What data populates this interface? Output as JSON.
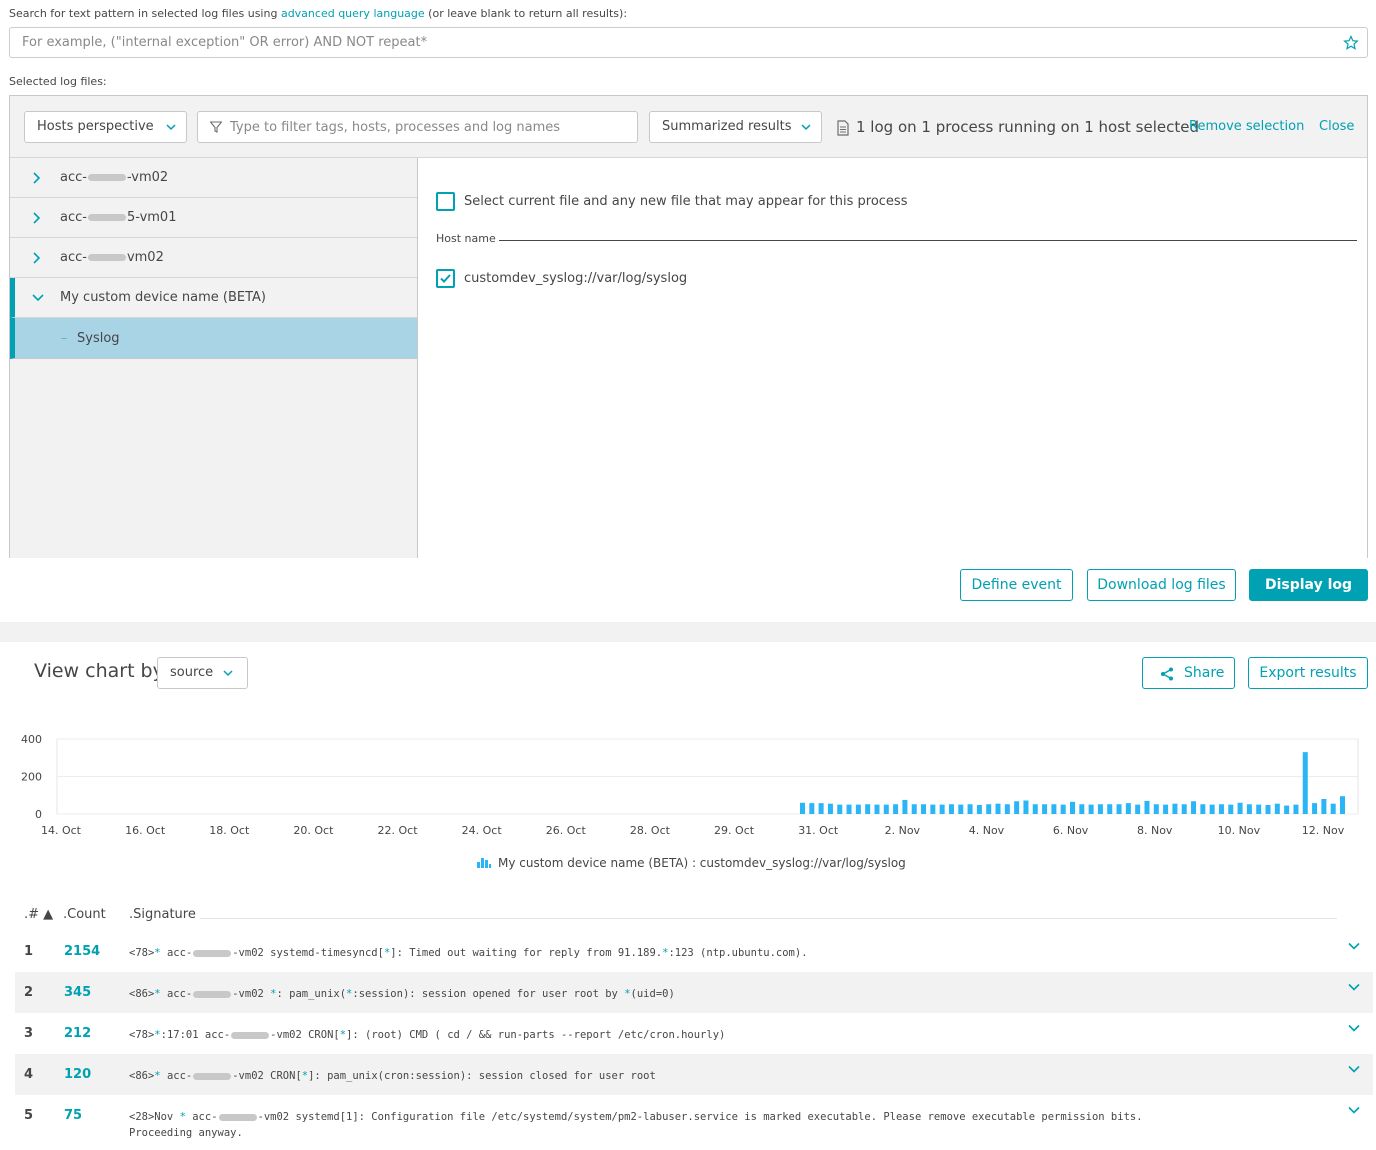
{
  "search": {
    "label_prefix": "Search for text pattern in selected log files using ",
    "label_link": "advanced query language",
    "label_suffix": " (or leave blank to return all results):",
    "placeholder": "For example, (\"internal exception\" OR error) AND NOT repeat*"
  },
  "selected_label": "Selected log files:",
  "toolbar": {
    "perspective": "Hosts perspective",
    "filter_placeholder": "Type to filter tags, hosts, processes and log names",
    "results_mode": "Summarized results",
    "selection_summary": "1 log on 1 process running on 1 host selected",
    "remove_selection": "Remove selection",
    "close": "Close"
  },
  "tree": {
    "items": [
      {
        "pre": "acc-",
        "post": "-vm02"
      },
      {
        "pre": "acc-",
        "post": "5-vm01"
      },
      {
        "pre": "acc-",
        "post": "vm02"
      },
      {
        "label": "My custom device name (BETA)"
      },
      {
        "label": "Syslog"
      }
    ]
  },
  "right_pane": {
    "select_current": "Select current file and any new file that may appear for this process",
    "host_name": "Host name",
    "file_entry": "customdev_syslog://var/log/syslog"
  },
  "actions": {
    "define_event": "Define event",
    "download": "Download log files",
    "display": "Display log"
  },
  "chart_section": {
    "view_by": "View chart by",
    "view_by_value": "source",
    "share": "Share",
    "export": "Export results"
  },
  "chart_data": {
    "type": "bar",
    "yticks": [
      "400",
      "200",
      "0"
    ],
    "xticks": [
      "14. Oct",
      "16. Oct",
      "18. Oct",
      "20. Oct",
      "22. Oct",
      "24. Oct",
      "26. Oct",
      "28. Oct",
      "29. Oct",
      "31. Oct",
      "2. Nov",
      "4. Nov",
      "6. Nov",
      "8. Nov",
      "10. Nov",
      "12. Nov"
    ],
    "ylim": [
      0,
      400
    ],
    "values": [
      60,
      58,
      58,
      55,
      50,
      50,
      50,
      52,
      50,
      50,
      52,
      75,
      52,
      52,
      50,
      50,
      52,
      50,
      52,
      48,
      52,
      55,
      52,
      68,
      72,
      52,
      52,
      52,
      50,
      65,
      52,
      50,
      52,
      52,
      52,
      58,
      50,
      70,
      52,
      50,
      55,
      52,
      68,
      52,
      50,
      52,
      50,
      60,
      52,
      50,
      48,
      55,
      45,
      50,
      330,
      58,
      80,
      55,
      95
    ],
    "series": [
      {
        "name": "My custom device name (BETA) : customdev_syslog://var/log/syslog",
        "color": "#2ab6f6"
      }
    ]
  },
  "table": {
    "headers": {
      "num": ".# ▲",
      "count": ".Count",
      "signature": ".Signature"
    },
    "rows": [
      {
        "num": "1",
        "count": "2154"
      },
      {
        "num": "2",
        "count": "345"
      },
      {
        "num": "3",
        "count": "212"
      },
      {
        "num": "4",
        "count": "120"
      },
      {
        "num": "5",
        "count": "75"
      }
    ]
  }
}
